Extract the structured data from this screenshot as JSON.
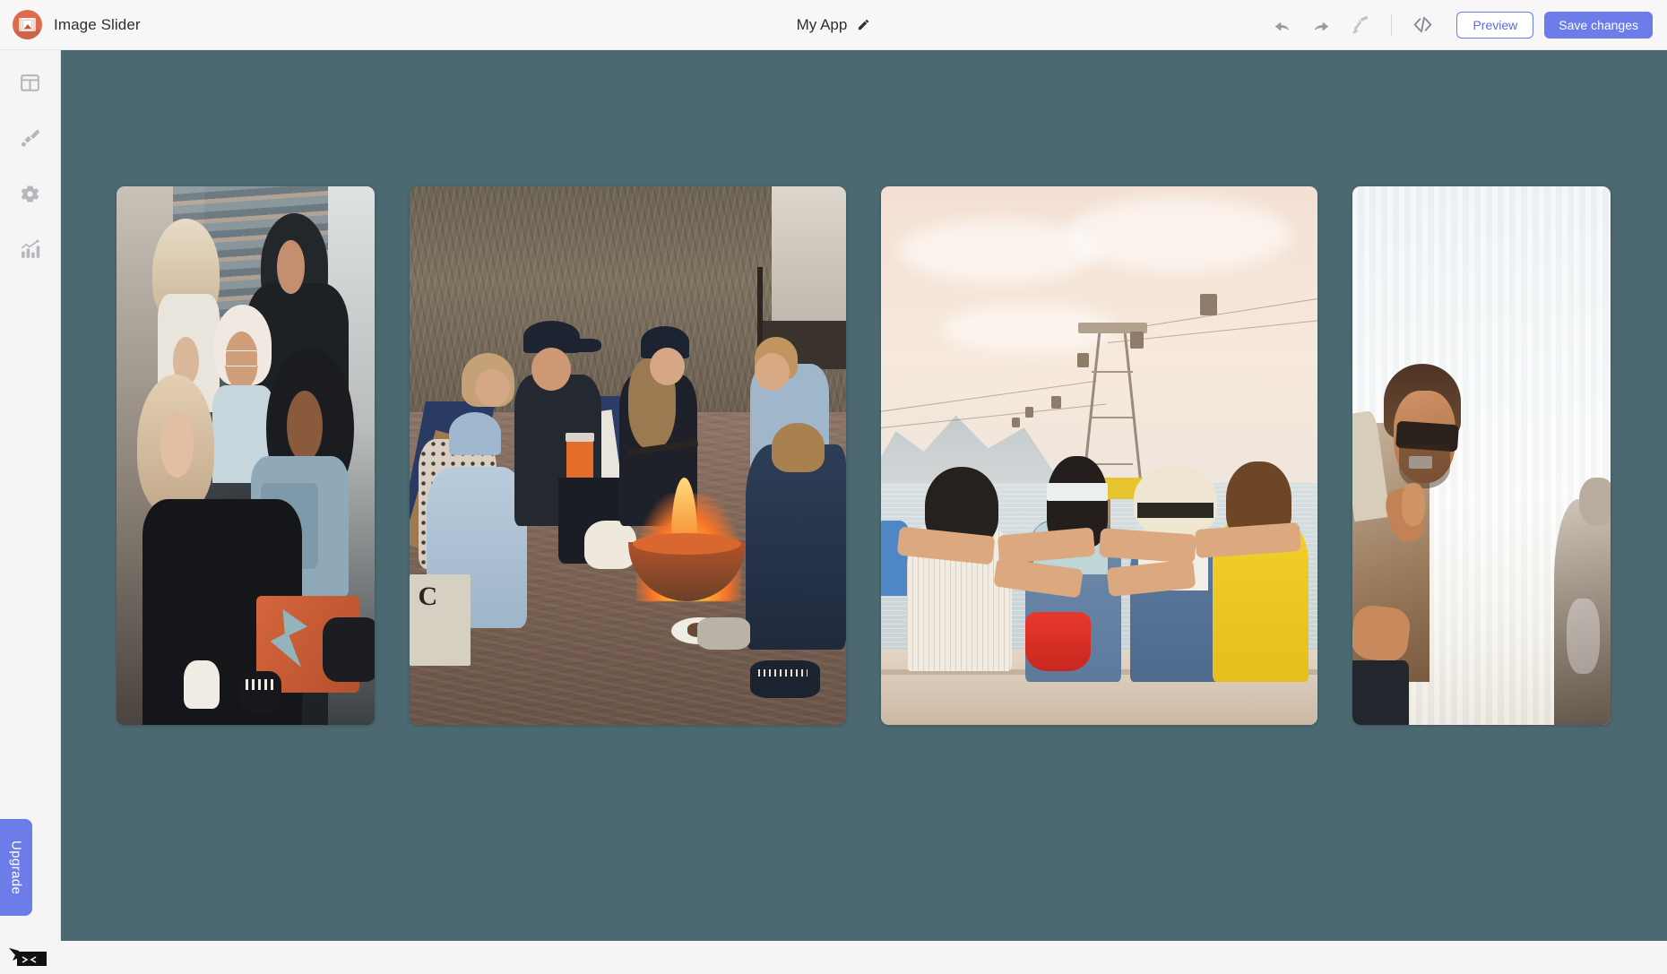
{
  "topbar": {
    "logo_icon": "image-slider-logo-icon",
    "app_title": "Image Slider",
    "project_name": "My App",
    "edit_icon": "pencil-icon",
    "undo_icon": "undo-arrow-icon",
    "redo_icon": "redo-arrow-icon",
    "paint_icon": "paint-roller-icon",
    "code_icon": "code-brackets-icon",
    "preview_label": "Preview",
    "save_label": "Save changes",
    "accent_color": "#6c7ce8",
    "logo_color": "#dd6b4d"
  },
  "sidebar": {
    "items": [
      {
        "name": "layout",
        "icon": "grid-layout-icon"
      },
      {
        "name": "design",
        "icon": "paint-brush-icon"
      },
      {
        "name": "settings",
        "icon": "gear-icon"
      },
      {
        "name": "analytics",
        "icon": "bar-chart-icon"
      }
    ],
    "upgrade_label": "Upgrade",
    "help_icon": "help-chat-bubble-icon",
    "background_color": "#f5f5f6"
  },
  "canvas": {
    "background_color": "#4c6870",
    "slider": {
      "slides": [
        {
          "index": 1,
          "alt": "Group of friends laughing together on concrete stairs"
        },
        {
          "index": 2,
          "alt": "Friends gathered around a bonfire on the beach at dusk"
        },
        {
          "index": 3,
          "alt": "Four friends sitting on a bench arm in arm watching cable cars over the sea"
        },
        {
          "index": 4,
          "alt": "Man in sunglasses laughing against a bright washed-out background"
        }
      ]
    }
  }
}
